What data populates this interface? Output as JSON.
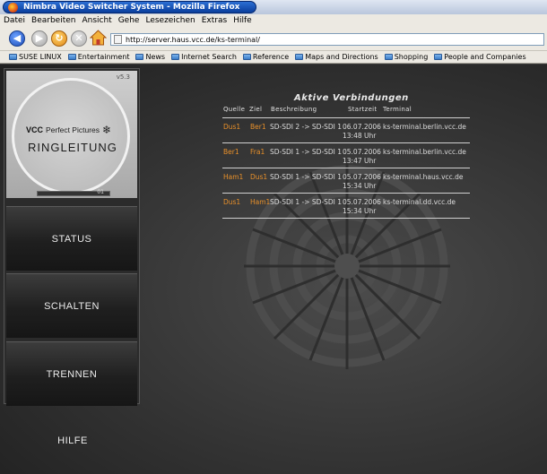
{
  "window": {
    "title": "Nimbra Video Switcher System - Mozilla Firefox"
  },
  "menu": {
    "items": [
      "Datei",
      "Bearbeiten",
      "Ansicht",
      "Gehe",
      "Lesezeichen",
      "Extras",
      "Hilfe"
    ]
  },
  "toolbar": {
    "url": "http://server.haus.vcc.de/ks-terminal/"
  },
  "bookmarks": {
    "items": [
      "SUSE LINUX",
      "Entertainment",
      "News",
      "Internet Search",
      "Reference",
      "Maps and Directions",
      "Shopping",
      "People and Companies"
    ]
  },
  "sidebar": {
    "version": "v5.3",
    "brand_bold": "VCC",
    "brand_light": "Perfect Pictures",
    "product": "RINGLEITUNG",
    "bar_label": "01",
    "nav": {
      "status": "STATUS",
      "schalten": "SCHALTEN",
      "trennen": "TRENNEN",
      "hilfe": "HILFE"
    }
  },
  "connections": {
    "title": "Aktive Verbindungen",
    "headers": {
      "source": "Quelle",
      "target": "Ziel",
      "description": "Beschreibung",
      "start": "Startzeit",
      "terminal": "Terminal"
    },
    "rows": [
      {
        "source": "Dus1",
        "target": "Ber1",
        "description": "SD-SDI 2 -> SD-SDI 1",
        "start": "06.07.2006 13:48 Uhr",
        "terminal": "ks-terminal.berlin.vcc.de"
      },
      {
        "source": "Ber1",
        "target": "Fra1",
        "description": "SD-SDI 1 -> SD-SDI 1",
        "start": "05.07.2006 13:47 Uhr",
        "terminal": "ks-terminal.berlin.vcc.de"
      },
      {
        "source": "Ham1",
        "target": "Dus1",
        "description": "SD-SDI 1 -> SD-SDI 1",
        "start": "05.07.2006 15:34 Uhr",
        "terminal": "ks-terminal.haus.vcc.de"
      },
      {
        "source": "Dus1",
        "target": "Ham1",
        "description": "SD-SDI 1 -> SD-SDI 1",
        "start": "05.07.2006 15:34 Uhr",
        "terminal": "ks-terminal.dd.vcc.de"
      }
    ]
  },
  "colors": {
    "accent_orange": "#e8902a",
    "titlebar_blue": "#0a3e9c"
  }
}
